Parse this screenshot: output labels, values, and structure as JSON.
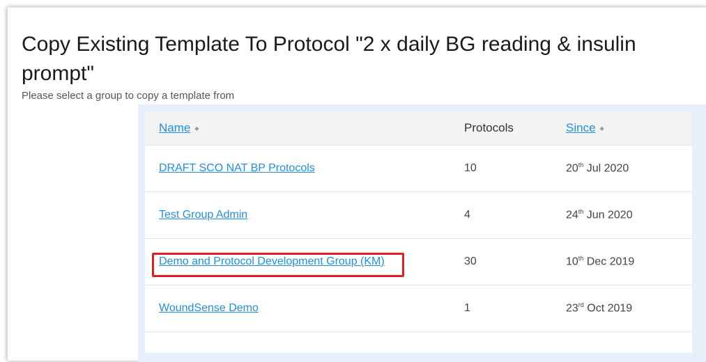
{
  "page": {
    "title": "Copy Existing Template To Protocol \"2 x daily BG reading & insulin prompt\"",
    "subtitle": "Please select a group to copy a template from"
  },
  "table": {
    "headers": {
      "name": "Name",
      "protocols": "Protocols",
      "since": "Since"
    },
    "rows": [
      {
        "name": "DRAFT SCO NAT BP Protocols",
        "protocols": "10",
        "since_day": "20",
        "since_suffix": "th",
        "since_rest": " Jul 2020"
      },
      {
        "name": "Test Group Admin",
        "protocols": "4",
        "since_day": "24",
        "since_suffix": "th",
        "since_rest": " Jun 2020"
      },
      {
        "name": "Demo and Protocol Development Group (KM)",
        "protocols": "30",
        "since_day": "10",
        "since_suffix": "th",
        "since_rest": " Dec 2019"
      },
      {
        "name": "WoundSense Demo",
        "protocols": "1",
        "since_day": "23",
        "since_suffix": "rd",
        "since_rest": " Oct 2019"
      }
    ]
  },
  "colors": {
    "link": "#1f8fe0",
    "highlight": "#e01f1f",
    "table_frame": "#e6f0fb"
  },
  "icons": {
    "sort": "sort-icon"
  }
}
